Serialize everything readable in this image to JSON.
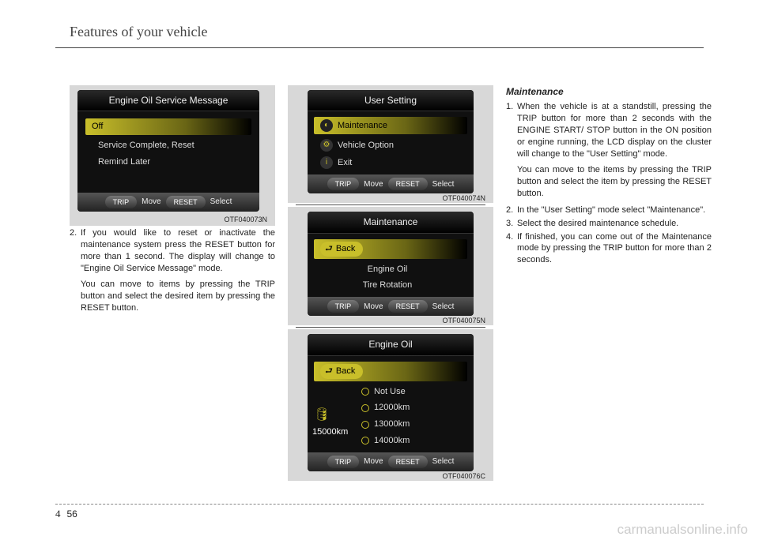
{
  "header": {
    "title": "Features of your vehicle"
  },
  "col1": {
    "screen": {
      "title": "Engine Oil Service Message",
      "row_hl": "Off",
      "row2": "Service Complete, Reset",
      "row3": "Remind Later",
      "footer": {
        "pill1": "TRIP",
        "lab1": "Move",
        "pill2": "RESET",
        "lab2": "Select"
      },
      "caption": "OTF040073N"
    },
    "item_num": "2.",
    "item_txt": "If you would like to reset or inactivate the maintenance system press the RESET button for more than 1 second. The display will change to \"Engine Oil Service Message\" mode.",
    "item_note": "You can move to items by pressing the TRIP button and select the desired item by pressing the RESET button."
  },
  "col2": {
    "screenA": {
      "title": "User Setting",
      "row_hl": "Maintenance",
      "row2": "Vehicle Option",
      "row3": "Exit",
      "footer": {
        "pill1": "TRIP",
        "lab1": "Move",
        "pill2": "RESET",
        "lab2": "Select"
      },
      "caption": "OTF040074N"
    },
    "screenB": {
      "title": "Maintenance",
      "back": "Back",
      "row2": "Engine Oil",
      "row3": "Tire Rotation",
      "footer": {
        "pill1": "TRIP",
        "lab1": "Move",
        "pill2": "RESET",
        "lab2": "Select"
      },
      "caption": "OTF040075N"
    },
    "screenC": {
      "title": "Engine Oil",
      "back": "Back",
      "side": "15000km",
      "opt1": "Not Use",
      "opt2": "12000km",
      "opt3": "13000km",
      "opt4": "14000km",
      "footer": {
        "pill1": "TRIP",
        "lab1": "Move",
        "pill2": "RESET",
        "lab2": "Select"
      },
      "caption": "OTF040076C"
    }
  },
  "col3": {
    "heading": "Maintenance",
    "i1_num": "1.",
    "i1_txt": "When the vehicle is at a standstill, pressing the TRIP button for more than 2 seconds with the ENGINE START/ STOP button in the ON position or engine running, the LCD display on the cluster will change to the \"User Setting\" mode.",
    "i1_note": "You can move to the items by pressing the TRIP button and select the item by pressing the RESET button.",
    "i2_num": "2.",
    "i2_txt": "In the \"User Setting\" mode select \"Maintenance\".",
    "i3_num": "3.",
    "i3_txt": "Select the desired maintenance schedule.",
    "i4_num": "4.",
    "i4_txt": "If finished, you can come out of the Maintenance mode by pressing the TRIP button for more than 2 seconds."
  },
  "footer": {
    "section": "4",
    "page": "56"
  },
  "watermark": "carmanualsonline.info"
}
